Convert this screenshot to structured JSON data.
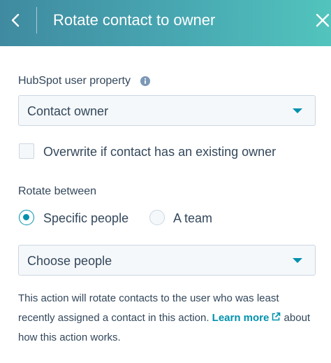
{
  "header": {
    "title": "Rotate contact to owner",
    "back_icon": "chevron-left-icon",
    "close_icon": "close-icon",
    "gradient_colors": [
      "#3f8aa0",
      "#52c4bd"
    ]
  },
  "property": {
    "label": "HubSpot user property",
    "info_icon": "info-icon",
    "selected": "Contact owner"
  },
  "overwrite": {
    "label": "Overwrite if contact has an existing owner",
    "checked": false
  },
  "rotate": {
    "label": "Rotate between",
    "options": [
      {
        "label": "Specific people",
        "checked": true
      },
      {
        "label": "A team",
        "checked": false
      }
    ],
    "people_select": "Choose people"
  },
  "help": {
    "text_before": "This action will rotate contacts to the user who was least recently assigned a contact in this action.",
    "link_label": "Learn more",
    "link_icon": "external-link-icon",
    "text_after": "about how this action works."
  },
  "colors": {
    "text": "#33475b",
    "accent": "#0091ae",
    "field_bg": "#f5f8fa",
    "field_border": "#cbd6e2"
  }
}
